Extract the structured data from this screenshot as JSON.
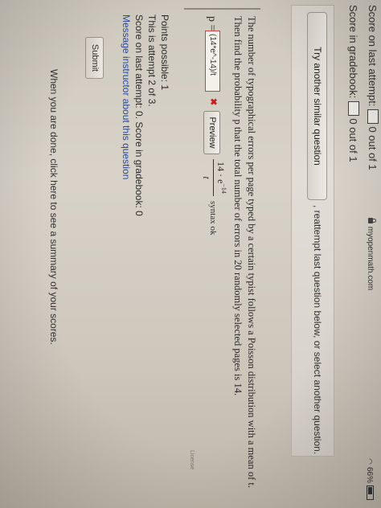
{
  "status_bar": {
    "domain": "myopenmath.com",
    "battery": "66%"
  },
  "score": {
    "last_attempt_label": "Score on last attempt:",
    "last_attempt_value": "0 out of 1",
    "gradebook_label": "Score in gradebook:",
    "gradebook_value": "0 out of 1"
  },
  "actions": {
    "try_another_label": "Try another similar question",
    "reattempt_text": ", reattempt last question below, or select another question."
  },
  "question": {
    "line1": "The number of typographical errors per page typed by a certain typist follows a Poisson distribution with a mean of t.",
    "line2": "Then find the probability p that the total number of errors in 20 randomly selected pages is 14.",
    "p_label": "p =",
    "answer_value": "(14*e^-14)/t",
    "preview_label": "Preview",
    "fraction_num": "14 · e",
    "fraction_exp": "−14",
    "fraction_den": "t",
    "syntax_status": "syntax ok"
  },
  "info": {
    "points_possible": "Points possible: 1",
    "attempt": "This is attempt 2 of 3.",
    "last_attempt_score": "Score on last attempt: 0. Score in gradebook: 0",
    "message_link": "Message instructor about this question"
  },
  "submit_label": "Submit",
  "summary_text": "When you are done, click here to see a summary of your scores.",
  "license_text": "License",
  "colors": {
    "error_red": "#c52020",
    "link_blue": "#2a4a9a"
  }
}
